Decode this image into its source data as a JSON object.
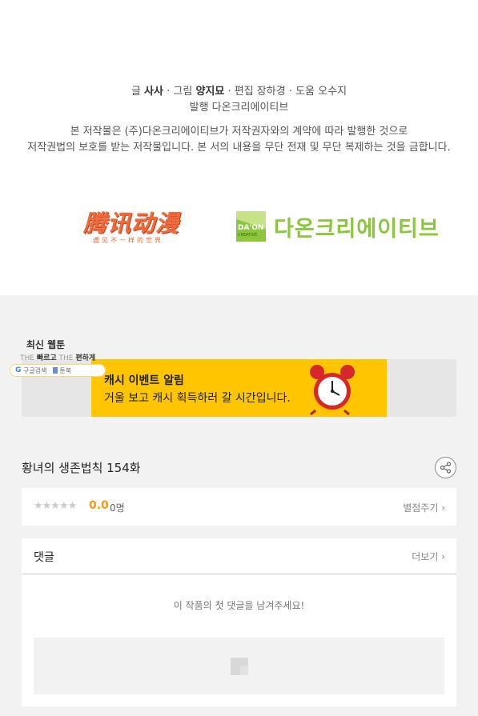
{
  "credits": {
    "writer_label": "글",
    "writer": "사사",
    "artist_label": "그림",
    "artist": "양지묘",
    "editor_label": "편집",
    "editor": "장하경",
    "assistant_label": "도움",
    "assistant": "오수지",
    "publisher_line": "발행 다온크리에이티브"
  },
  "notice": {
    "line1": "본 저작물은 (주)다온크리에이티브가 저작권자와의 계약에 따라 발행한 것으로",
    "line2": "저작권법의 보호를 받는 저작물입니다. 본 서의 내용을 무단 전재 및 무단 복제하는 것을 금합니다."
  },
  "logos": {
    "tencent_main": "腾讯动漫",
    "tencent_sub": "遇见不一样的世界",
    "daon_box_line1": "DA'ON",
    "daon_box_line2": "CREATIVE",
    "daon_text": "다온크리에이티브"
  },
  "sticker": {
    "title": "최신 웹툰",
    "slogan_the1": "THE",
    "slogan_fast": "빠르고",
    "slogan_the2": "THE",
    "slogan_easy": "편하게",
    "google_label": "구글검색",
    "toonbook_label": "툰북"
  },
  "banner": {
    "title": "캐시 이벤트 알림",
    "subtitle": "거울 보고 캐시 획득하러 갈 시간입니다."
  },
  "episode": {
    "title": "황녀의 생존법칙 154화"
  },
  "rating": {
    "stars": "★★★★★",
    "score": "0.0",
    "count": "0명",
    "rate_link": "별점주기 ›"
  },
  "comments": {
    "title": "댓글",
    "more": "더보기 ›",
    "empty_message": "이 작품의 첫 댓글을 남겨주세요!"
  },
  "colors": {
    "banner_bg": "#ffc600",
    "score": "#f39c12",
    "daon_green": "#8cc63f",
    "tencent_orange": "#f06a3b"
  }
}
